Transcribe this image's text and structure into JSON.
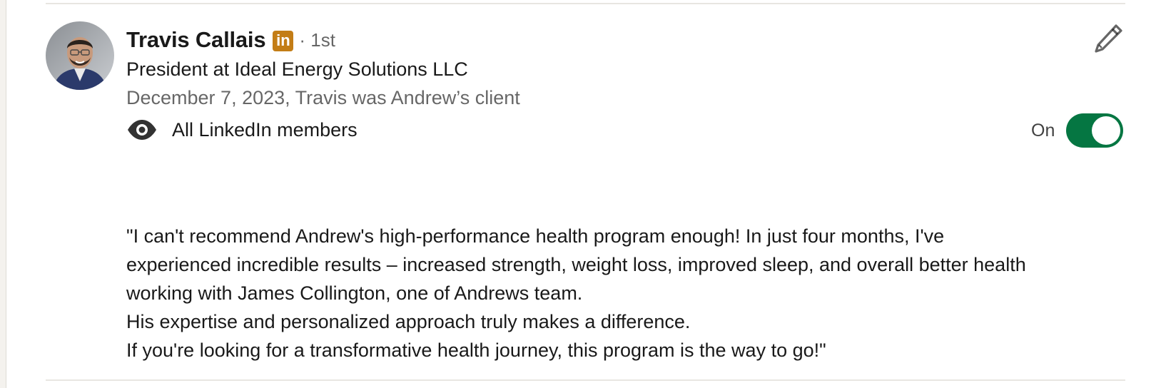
{
  "person": {
    "name": "Travis Callais",
    "badge": "in",
    "degree": "· 1st",
    "headline": "President at Ideal Energy Solutions LLC",
    "relationship": "December 7, 2023, Travis was Andrew’s client"
  },
  "visibility": {
    "icon": "eye-icon",
    "label": "All LinkedIn members"
  },
  "toggle": {
    "state_label": "On",
    "is_on": true,
    "color": "#057642"
  },
  "edit": {
    "icon": "pencil-icon"
  },
  "recommendation": {
    "lines": [
      "\"I can't recommend Andrew's high-performance health program enough! In just four months, I've",
      "experienced incredible results – increased strength, weight loss, improved sleep, and overall better health",
      "working with James Collington, one of Andrews team.",
      "His expertise and personalized approach truly makes a difference.",
      "If you're looking for a transformative health journey, this program is the way to go!\""
    ]
  },
  "colors": {
    "badge": "#c37d16",
    "toggle_on": "#057642"
  }
}
